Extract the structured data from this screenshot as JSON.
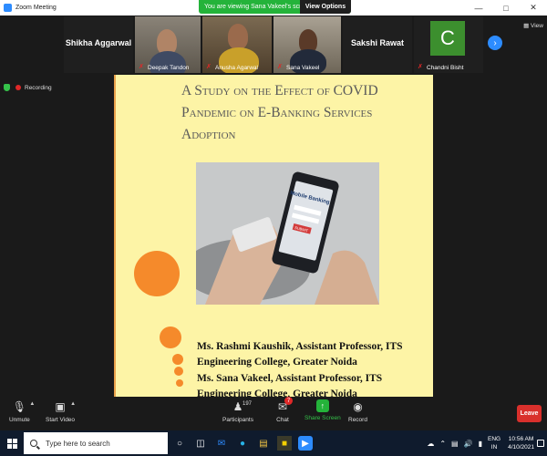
{
  "window": {
    "title": "Zoom Meeting"
  },
  "share_banner": {
    "message": "You are viewing Sana Vakeel's screen",
    "view_options": "View Options"
  },
  "gallery": {
    "tiles": [
      {
        "name": "Shikha Aggarwal"
      },
      {
        "name": "Deepak Tandon"
      },
      {
        "name": "Anusha Agarwal"
      },
      {
        "name": "Sana Vakeel"
      },
      {
        "name": "Sakshi Rawat"
      },
      {
        "name": "Chandni Bisht",
        "avatar_letter": "C"
      }
    ],
    "view_label": "View"
  },
  "status": {
    "recording_label": "Recording"
  },
  "slide": {
    "title": "A Study on the Effect of COVID Pandemic on E-Banking Services Adoption",
    "photo_screen_title": "Mobile Banking",
    "photo_button": "SUBMIT",
    "authors": [
      "Ms. Rashmi Kaushik, Assistant Professor, ITS Engineering College, Greater Noida",
      "Ms. Sana Vakeel, Assistant Professor, ITS Engineering College, Greater Noida"
    ],
    "accent_color": "#f58a2b",
    "background_color": "#fdf4a6"
  },
  "toolbar": {
    "unmute": "Unmute",
    "start_video": "Start Video",
    "participants": "Participants",
    "participants_count": "197",
    "chat": "Chat",
    "chat_badge": "7",
    "share_screen": "Share Screen",
    "record": "Record",
    "leave": "Leave"
  },
  "taskbar": {
    "search_placeholder": "Type here to search",
    "language": "ENG",
    "region": "IN",
    "time": "10:56 AM",
    "date": "4/10/2021"
  },
  "colors": {
    "zoom_blue": "#2d8cff",
    "share_green": "#24b33a",
    "leave_red": "#d9302c"
  }
}
